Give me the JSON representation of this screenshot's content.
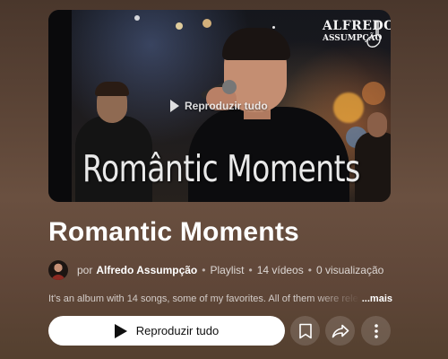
{
  "thumbnail": {
    "overlay_label": "Reproduzir tudo",
    "title_text": "Romântic Moments",
    "logo": {
      "line1": "ALFREDO",
      "line2": "ASSUMPÇÃO"
    }
  },
  "playlist": {
    "title": "Romantic Moments",
    "author_prefix": "por",
    "author": "Alfredo Assumpção",
    "type": "Playlist",
    "video_count": "14 vídeos",
    "views": "0 visualização",
    "separator": "•",
    "description": "It's an album with 14 songs, some of my favorites. All of them were released",
    "more_label": "...mais"
  },
  "actions": {
    "play_all_label": "Reproduzir tudo",
    "save_icon": "bookmark-icon",
    "share_icon": "share-icon",
    "more_icon": "more-vertical-icon"
  },
  "colors": {
    "background": "#5b4436",
    "primary_button": "#ffffff",
    "circle_button": "rgba(255,255,255,0.14)"
  }
}
